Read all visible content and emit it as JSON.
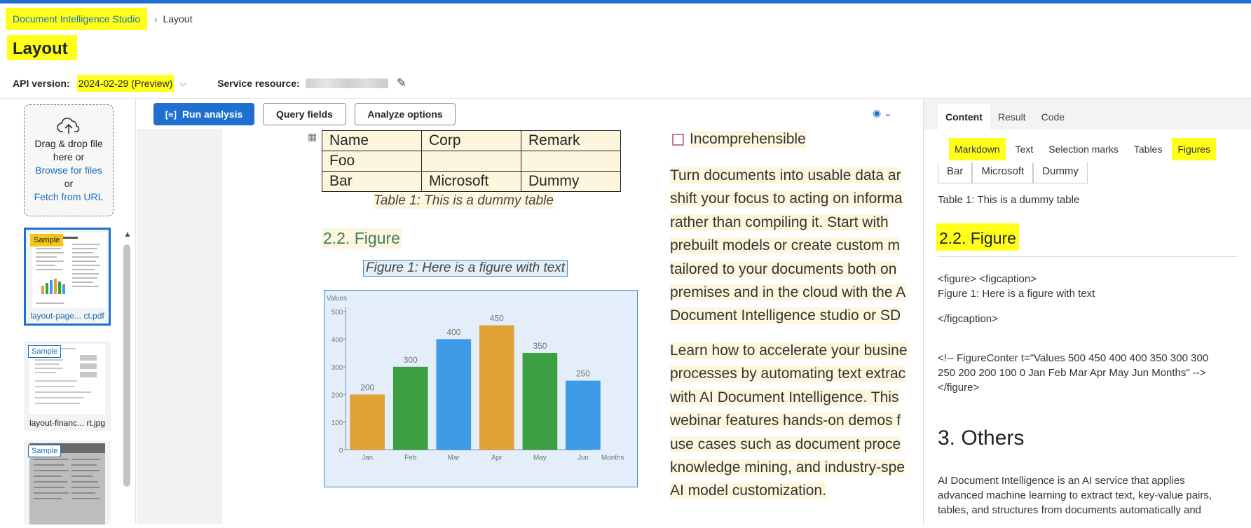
{
  "breadcrumb": {
    "root": "Document Intelligence Studio",
    "current": "Layout"
  },
  "page_title": "Layout",
  "api": {
    "version_label": "API version:",
    "version_value": "2024-02-29 (Preview)",
    "resource_label": "Service resource:"
  },
  "dropzone": {
    "line1": "Drag & drop file",
    "line2": "here or",
    "browse": "Browse for files",
    "or": "or",
    "fetch": "Fetch from URL"
  },
  "thumbnails": [
    {
      "tag": "Sample",
      "name": "layout-page... ct.pdf"
    },
    {
      "tag": "Sample",
      "name": "layout-financ... rt.jpg"
    },
    {
      "tag": "Sample",
      "name": ""
    }
  ],
  "toolbar": {
    "run": "Run analysis",
    "query": "Query fields",
    "options": "Analyze options"
  },
  "document": {
    "table_rows": [
      [
        "Name",
        "Corp",
        "Remark"
      ],
      [
        "Foo",
        "",
        ""
      ],
      [
        "Bar",
        "Microsoft",
        "Dummy"
      ]
    ],
    "table_caption": "Table 1: This is a dummy table",
    "heading": "2.2. Figure",
    "figure_caption": "Figure 1: Here is a figure with text",
    "checkbox_label": "Incomprehensible",
    "para1": [
      "Turn documents into usable data ar",
      "shift your focus to acting on informa",
      "rather than compiling it. Start with",
      "prebuilt models or create custom m",
      "tailored to your documents both on",
      "premises and in the cloud with the A",
      "Document Intelligence studio or SD"
    ],
    "para2": [
      "Learn how to accelerate your busine",
      "processes by automating text extrac",
      "with AI Document Intelligence. This",
      "webinar features hands-on demos f",
      "use cases such as document proce",
      "knowledge mining, and industry-spe",
      "AI model customization."
    ]
  },
  "chart_data": {
    "type": "bar",
    "categories": [
      "Jan",
      "Feb",
      "Mar",
      "Apr",
      "May",
      "Jun"
    ],
    "values": [
      200,
      300,
      400,
      450,
      350,
      250
    ],
    "colors": [
      "#e0a236",
      "#3ca043",
      "#3e9be5",
      "#e0a236",
      "#3ca043",
      "#3e9be5"
    ],
    "ylabel": "Values",
    "xlabel": "Months",
    "ylim": [
      0,
      500
    ],
    "yticks": [
      0,
      100,
      200,
      300,
      400,
      500
    ]
  },
  "right_panel": {
    "tabs": [
      "Content",
      "Result",
      "Code"
    ],
    "subtabs": [
      "Markdown",
      "Text",
      "Selection marks",
      "Tables",
      "Figures"
    ],
    "table_row": [
      "Bar",
      "Microsoft",
      "Dummy"
    ],
    "table_caption": "Table 1: This is a dummy table",
    "heading": "2.2. Figure",
    "figure_open": "<figure> <figcaption>",
    "figure_caption": "Figure 1: Here is a figure with text",
    "figcaption_close": "</figcaption>",
    "comment_line1": "<!-- FigureConter t=\"Values 500 450 400 400 350 300 300",
    "comment_line2": "250 200 200 100 0 Jan Feb Mar Apr May Jun Months\" -->",
    "figure_close": "</figure>",
    "heading2": "3. Others",
    "para1": "AI Document Intelligence is an AI service that applies",
    "para2": "advanced machine learning to extract text, key-value pairs,",
    "para3": "tables, and structures from documents automatically and"
  }
}
